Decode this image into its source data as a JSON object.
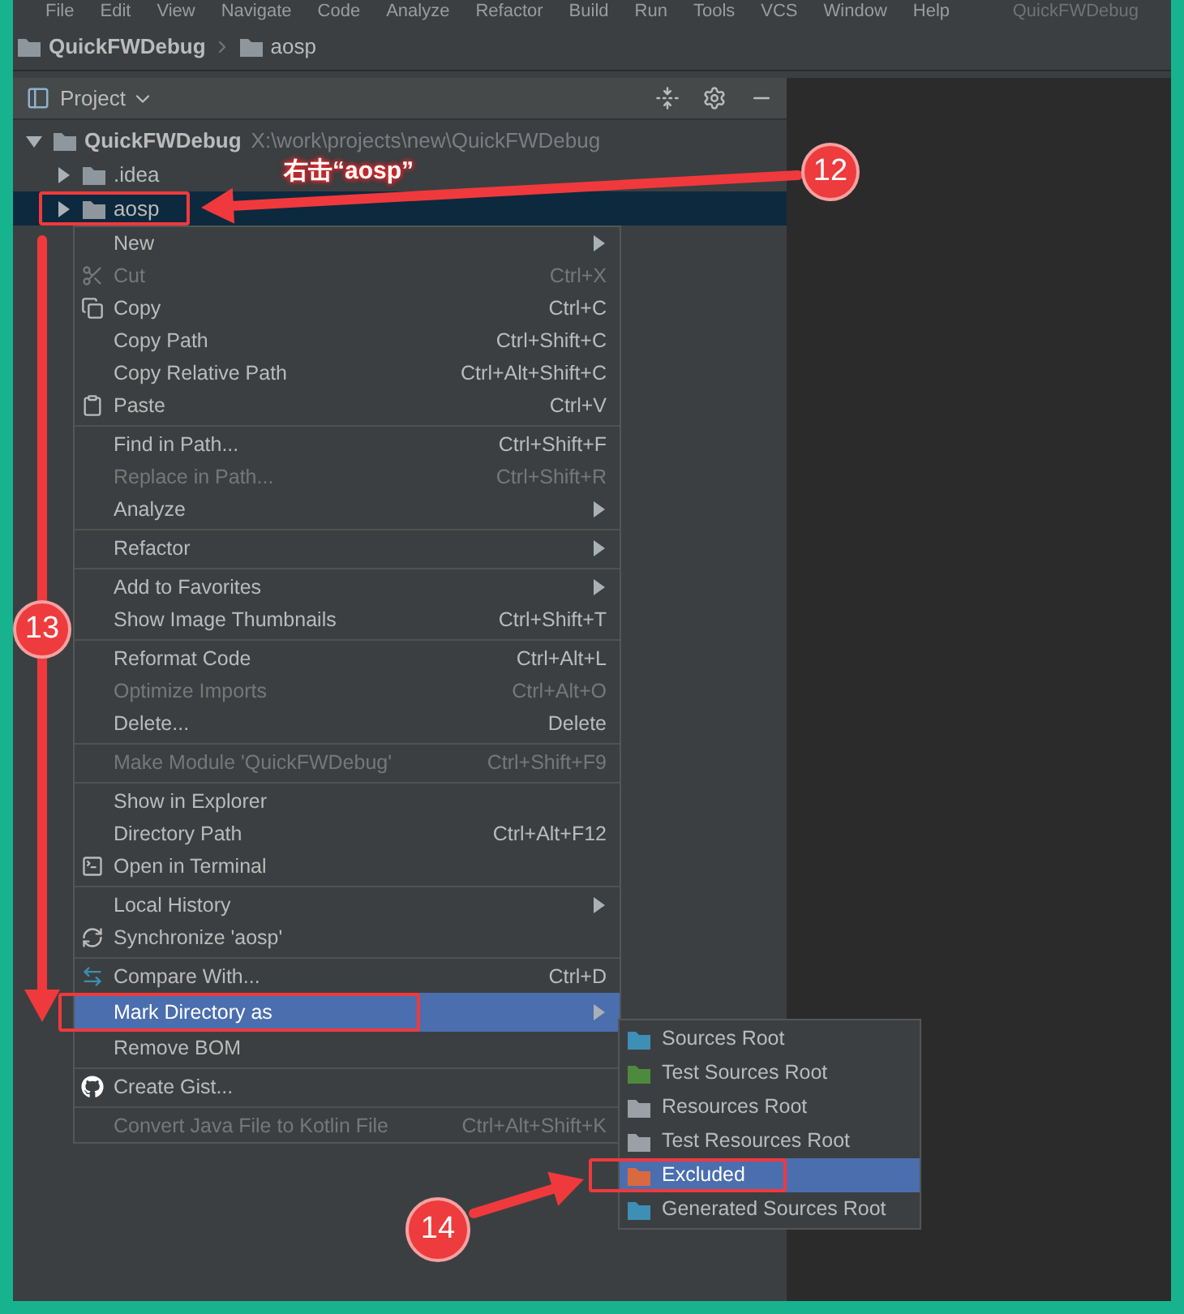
{
  "menubar": {
    "items": [
      "File",
      "Edit",
      "View",
      "Navigate",
      "Code",
      "Analyze",
      "Refactor",
      "Build",
      "Run",
      "Tools",
      "VCS",
      "Window",
      "Help"
    ],
    "window_title": "QuickFWDebug"
  },
  "breadcrumb": [
    "QuickFWDebug",
    "aosp"
  ],
  "project_panel": {
    "title": "Project",
    "tree": [
      {
        "label": "QuickFWDebug",
        "path": "X:\\work\\projects\\new\\QuickFWDebug",
        "expanded": true,
        "selected": false,
        "children": [
          {
            "label": ".idea",
            "expanded": false,
            "selected": false
          },
          {
            "label": "aosp",
            "expanded": false,
            "selected": true
          }
        ]
      }
    ]
  },
  "context_menu": {
    "items": [
      {
        "kind": "item",
        "label": "New",
        "submenu": true,
        "disabled": false,
        "selected": false
      },
      {
        "kind": "item",
        "label": "Cut",
        "shortcut": "Ctrl+X",
        "submenu": false,
        "disabled": true,
        "selected": false
      },
      {
        "kind": "item",
        "label": "Copy",
        "shortcut": "Ctrl+C",
        "submenu": false,
        "disabled": false,
        "selected": false
      },
      {
        "kind": "item",
        "label": "Copy Path",
        "shortcut": "Ctrl+Shift+C",
        "submenu": false,
        "disabled": false,
        "selected": false
      },
      {
        "kind": "item",
        "label": "Copy Relative Path",
        "shortcut": "Ctrl+Alt+Shift+C",
        "submenu": false,
        "disabled": false,
        "selected": false
      },
      {
        "kind": "item",
        "label": "Paste",
        "shortcut": "Ctrl+V",
        "submenu": false,
        "disabled": false,
        "selected": false
      },
      {
        "kind": "separator"
      },
      {
        "kind": "item",
        "label": "Find in Path...",
        "shortcut": "Ctrl+Shift+F",
        "submenu": false,
        "disabled": false,
        "selected": false
      },
      {
        "kind": "item",
        "label": "Replace in Path...",
        "shortcut": "Ctrl+Shift+R",
        "submenu": false,
        "disabled": true,
        "selected": false
      },
      {
        "kind": "item",
        "label": "Analyze",
        "submenu": true,
        "disabled": false,
        "selected": false
      },
      {
        "kind": "separator"
      },
      {
        "kind": "item",
        "label": "Refactor",
        "submenu": true,
        "disabled": false,
        "selected": false
      },
      {
        "kind": "separator"
      },
      {
        "kind": "item",
        "label": "Add to Favorites",
        "submenu": true,
        "disabled": false,
        "selected": false
      },
      {
        "kind": "item",
        "label": "Show Image Thumbnails",
        "shortcut": "Ctrl+Shift+T",
        "submenu": false,
        "disabled": false,
        "selected": false
      },
      {
        "kind": "separator"
      },
      {
        "kind": "item",
        "label": "Reformat Code",
        "shortcut": "Ctrl+Alt+L",
        "submenu": false,
        "disabled": false,
        "selected": false
      },
      {
        "kind": "item",
        "label": "Optimize Imports",
        "shortcut": "Ctrl+Alt+O",
        "submenu": false,
        "disabled": true,
        "selected": false
      },
      {
        "kind": "item",
        "label": "Delete...",
        "shortcut": "Delete",
        "submenu": false,
        "disabled": false,
        "selected": false
      },
      {
        "kind": "separator"
      },
      {
        "kind": "item",
        "label": "Make Module 'QuickFWDebug'",
        "shortcut": "Ctrl+Shift+F9",
        "submenu": false,
        "disabled": true,
        "selected": false
      },
      {
        "kind": "separator"
      },
      {
        "kind": "item",
        "label": "Show in Explorer",
        "submenu": false,
        "disabled": false,
        "selected": false
      },
      {
        "kind": "item",
        "label": "Directory Path",
        "shortcut": "Ctrl+Alt+F12",
        "submenu": false,
        "disabled": false,
        "selected": false
      },
      {
        "kind": "item",
        "label": "Open in Terminal",
        "submenu": false,
        "disabled": false,
        "selected": false
      },
      {
        "kind": "separator"
      },
      {
        "kind": "item",
        "label": "Local History",
        "submenu": true,
        "disabled": false,
        "selected": false
      },
      {
        "kind": "item",
        "label": "Synchronize 'aosp'",
        "submenu": false,
        "disabled": false,
        "selected": false
      },
      {
        "kind": "separator"
      },
      {
        "kind": "item",
        "label": "Compare With...",
        "shortcut": "Ctrl+D",
        "submenu": false,
        "disabled": false,
        "selected": false
      },
      {
        "kind": "item",
        "label": "Mark Directory as",
        "submenu": true,
        "disabled": false,
        "selected": true
      },
      {
        "kind": "item",
        "label": "Remove BOM",
        "submenu": false,
        "disabled": false,
        "selected": false
      },
      {
        "kind": "separator"
      },
      {
        "kind": "item",
        "label": "Create Gist...",
        "submenu": false,
        "disabled": false,
        "selected": false
      },
      {
        "kind": "separator"
      },
      {
        "kind": "item",
        "label": "Convert Java File to Kotlin File",
        "shortcut": "Ctrl+Alt+Shift+K",
        "submenu": false,
        "disabled": true,
        "selected": false
      }
    ]
  },
  "mark_submenu": {
    "items": [
      {
        "label": "Sources Root",
        "color": "#3d8fb5",
        "selected": false
      },
      {
        "label": "Test Sources Root",
        "color": "#4e8a3e",
        "selected": false
      },
      {
        "label": "Resources Root",
        "color": "#9aa0a6",
        "selected": false
      },
      {
        "label": "Test Resources Root",
        "color": "#9aa0a6",
        "selected": false
      },
      {
        "label": "Excluded",
        "color": "#d9693f",
        "selected": true
      },
      {
        "label": "Generated Sources Root",
        "color": "#3d8fb5",
        "selected": false
      }
    ]
  },
  "annotations": {
    "steps": [
      "12",
      "13",
      "14"
    ],
    "callout": "右击“aosp”"
  }
}
